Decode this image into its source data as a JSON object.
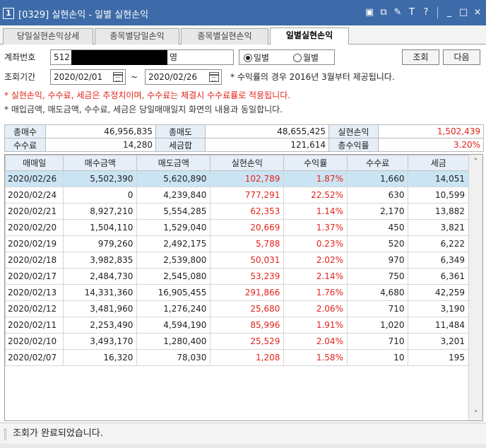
{
  "window": {
    "number": "1",
    "title": "[0329] 실현손익 - 일별 실현손익",
    "icons": [
      "window-restore-icon",
      "popout-icon",
      "pin-icon",
      "text-size-icon",
      "help-icon",
      "minimize-icon",
      "maximize-icon",
      "close-icon"
    ],
    "icon_glyphs": {
      "restore": "▣",
      "popout": "⧉",
      "pin": "✎",
      "font": "T",
      "help": "?",
      "minimize": "_",
      "maximize": "□",
      "close": "×"
    }
  },
  "tabs": [
    {
      "label": "당일실현손익상세",
      "active": false
    },
    {
      "label": "종목별당일손익",
      "active": false
    },
    {
      "label": "종목별실현손익",
      "active": false
    },
    {
      "label": "일별실현손익",
      "active": true
    }
  ],
  "search": {
    "account_label": "계좌번호",
    "account_prefix": "512",
    "account_name_suffix": "영",
    "radio_daily": "일별",
    "radio_monthly": "월별",
    "selected": "daily",
    "query_button": "조회",
    "next_button": "다음",
    "period_label": "조회기간",
    "date_from": "2020/02/01",
    "date_sep": "~",
    "date_to": "2020/02/26",
    "period_note": "* 수익률의 경우 2016년 3월부터 제공됩니다."
  },
  "notes": {
    "red": "* 실현손익, 수수료, 세금은 추정치이며, 수수료는 체결시 수수료률로 적용됩니다.",
    "gray": "* 매입금액, 매도금액, 수수료, 세금은 당일매매일지 화면의 내용과 동일합니다."
  },
  "summary": {
    "total_buy_label": "총매수",
    "total_buy": "46,956,835",
    "total_sell_label": "총매도",
    "total_sell": "48,655,425",
    "realized_label": "실현손익",
    "realized": "1,502,439",
    "fee_label": "수수료",
    "fee": "14,280",
    "tax_label": "세금합",
    "tax": "121,614",
    "return_label": "총수익률",
    "return": "3.20%"
  },
  "table": {
    "headers": [
      "매매일",
      "매수금액",
      "매도금액",
      "실현손익",
      "수익률",
      "수수료",
      "세금"
    ],
    "rows": [
      [
        "2020/02/26",
        "5,502,390",
        "5,620,890",
        "102,789",
        "1.87%",
        "1,660",
        "14,051"
      ],
      [
        "2020/02/24",
        "0",
        "4,239,840",
        "777,291",
        "22.52%",
        "630",
        "10,599"
      ],
      [
        "2020/02/21",
        "8,927,210",
        "5,554,285",
        "62,353",
        "1.14%",
        "2,170",
        "13,882"
      ],
      [
        "2020/02/20",
        "1,504,110",
        "1,529,040",
        "20,669",
        "1.37%",
        "450",
        "3,821"
      ],
      [
        "2020/02/19",
        "979,260",
        "2,492,175",
        "5,788",
        "0.23%",
        "520",
        "6,222"
      ],
      [
        "2020/02/18",
        "3,982,835",
        "2,539,800",
        "50,031",
        "2.02%",
        "970",
        "6,349"
      ],
      [
        "2020/02/17",
        "2,484,730",
        "2,545,080",
        "53,239",
        "2.14%",
        "750",
        "6,361"
      ],
      [
        "2020/02/13",
        "14,331,360",
        "16,905,455",
        "291,866",
        "1.76%",
        "4,680",
        "42,259"
      ],
      [
        "2020/02/12",
        "3,481,960",
        "1,276,240",
        "25,680",
        "2.06%",
        "710",
        "3,190"
      ],
      [
        "2020/02/11",
        "2,253,490",
        "4,594,190",
        "85,996",
        "1.91%",
        "1,020",
        "11,484"
      ],
      [
        "2020/02/10",
        "3,493,170",
        "1,280,400",
        "25,529",
        "2.04%",
        "710",
        "3,201"
      ],
      [
        "2020/02/07",
        "16,320",
        "78,030",
        "1,208",
        "1.58%",
        "10",
        "195"
      ]
    ],
    "selected_row": 0
  },
  "status": {
    "message": "조회가 완료되었습니다."
  },
  "colors": {
    "title_bar": "#3d6aa8",
    "profit_red": "#e2231a",
    "header_bg": "#e6eef8",
    "selected_row": "#cbe4f3"
  }
}
